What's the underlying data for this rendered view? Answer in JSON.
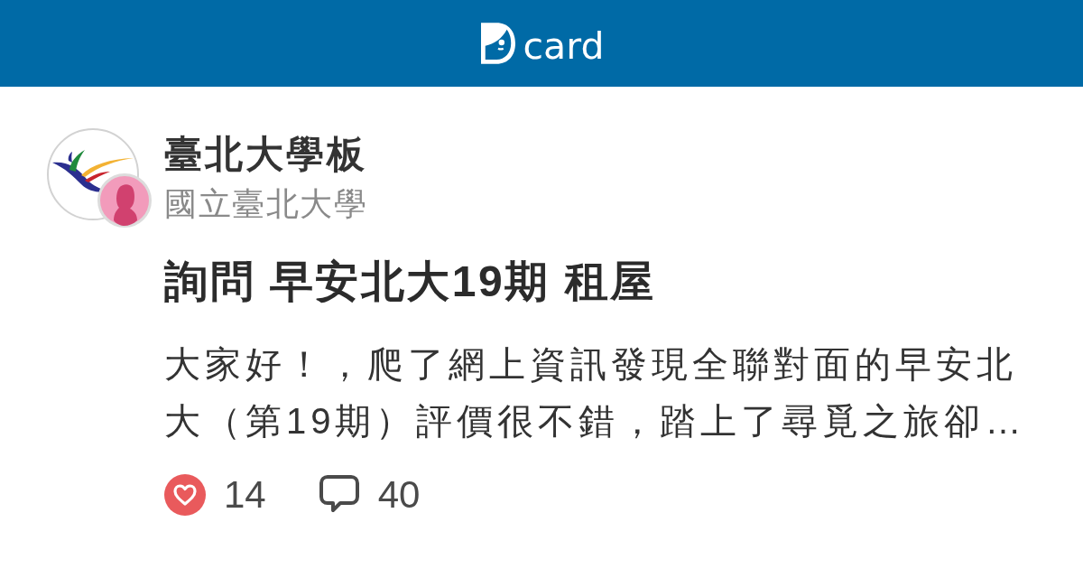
{
  "header": {
    "logo_text": "card"
  },
  "board": {
    "name": "臺北大學板",
    "school": "國立臺北大學"
  },
  "post": {
    "title": "詢問 早安北大19期 租屋",
    "excerpt": "大家好！，爬了網上資訊發現全聯對面的早安北大（第19期）評價很不錯，踏上了尋覓之旅卻…"
  },
  "stats": {
    "likes": "14",
    "comments": "40"
  }
}
